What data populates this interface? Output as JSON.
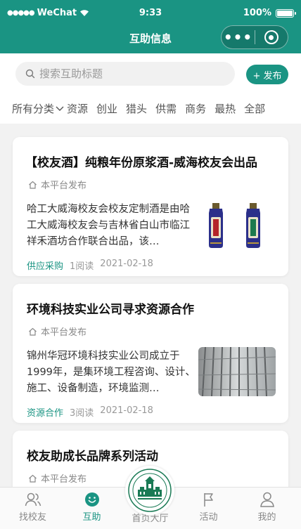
{
  "status_bar": {
    "carrier": "WeChat",
    "time": "9:33",
    "battery": "100%",
    "battery_level": 1.0
  },
  "nav": {
    "title": "互助信息",
    "more_icon": "more-dots-icon",
    "close_icon": "target-close-icon"
  },
  "search": {
    "placeholder": "搜索互助标题",
    "value": ""
  },
  "post_button": {
    "label": "+ 发布"
  },
  "categories": {
    "dropdown_label": "所有分类",
    "items": [
      "资源",
      "创业",
      "猎头",
      "供需",
      "商务",
      "最热",
      "全部"
    ]
  },
  "posts": [
    {
      "title": "【校友酒】纯粮年份原浆酒-威海校友会出品",
      "publisher": "本平台发布",
      "description": "哈工大威海校友会校友定制酒是由哈工大威海校友会与吉林省白山市临江祥禾酒坊合作联合出品，该…",
      "tag": "供应采购",
      "reads": "1阅读",
      "date": "2021-02-18",
      "image": "liquor-bottles-image"
    },
    {
      "title": "环境科技实业公司寻求资源合作",
      "publisher": "本平台发布",
      "description": "锦州华冠环境科技实业公司成立于1999年，是集环境工程咨询、设计、施工、设备制造，环境监测…",
      "tag": "资源合作",
      "reads": "3阅读",
      "date": "2021-02-18",
      "image": "building-interior-image"
    },
    {
      "title": "校友助成长品牌系列活动",
      "publisher": "本平台发布"
    }
  ],
  "colors": {
    "brand": "#1a9483",
    "tag": "#1a9483"
  },
  "tabbar": {
    "items": [
      {
        "label": "找校友",
        "icon": "users-icon"
      },
      {
        "label": "互助",
        "icon": "smile-icon",
        "active": true
      },
      {
        "label": "首页大厅",
        "icon": "school-emblem-icon"
      },
      {
        "label": "活动",
        "icon": "flag-icon"
      },
      {
        "label": "我的",
        "icon": "person-icon"
      }
    ]
  }
}
